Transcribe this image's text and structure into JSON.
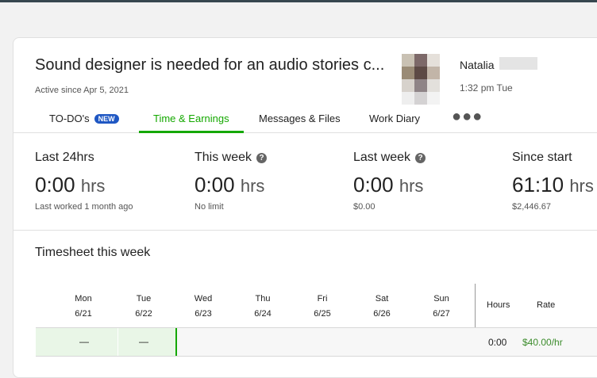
{
  "contract": {
    "title": "Sound designer is needed for an audio stories c...",
    "active_since": "Active since Apr 5, 2021"
  },
  "client": {
    "name": "Natalia",
    "local_time": "1:32 pm Tue",
    "avatar_colors": [
      "#c9c1b3",
      "#7d6969",
      "#e5e0da",
      "#9a8b76",
      "#5d4a45",
      "#c2b5a8",
      "#d7d2cc",
      "#8f8487",
      "#e3e0dc",
      "#eeeeee",
      "#d4d2d3",
      "#f3f3f3"
    ]
  },
  "tabs": [
    {
      "label": "TO-DO's",
      "badge": "NEW"
    },
    {
      "label": "Time & Earnings"
    },
    {
      "label": "Messages & Files"
    },
    {
      "label": "Work Diary"
    }
  ],
  "more_icon": "●●●",
  "stats": [
    {
      "label": "Last 24hrs",
      "value": "0:00",
      "unit": "hrs",
      "sub": "Last worked 1 month ago"
    },
    {
      "label": "This week",
      "value": "0:00",
      "unit": "hrs",
      "sub": "No limit",
      "help": "?"
    },
    {
      "label": "Last week",
      "value": "0:00",
      "unit": "hrs",
      "sub": "$0.00",
      "help": "?"
    },
    {
      "label": "Since start",
      "value": "61:10",
      "unit": "hrs",
      "sub": "$2,446.67"
    }
  ],
  "timesheet": {
    "title": "Timesheet this week",
    "days": [
      {
        "name": "Mon",
        "date": "6/21"
      },
      {
        "name": "Tue",
        "date": "6/22"
      },
      {
        "name": "Wed",
        "date": "6/23"
      },
      {
        "name": "Thu",
        "date": "6/24"
      },
      {
        "name": "Fri",
        "date": "6/25"
      },
      {
        "name": "Sat",
        "date": "6/26"
      },
      {
        "name": "Sun",
        "date": "6/27"
      }
    ],
    "headers": {
      "hours": "Hours",
      "rate": "Rate"
    },
    "row": {
      "mon": "—",
      "tue": "—",
      "hours": "0:00",
      "rate": "$40.00/hr"
    }
  }
}
